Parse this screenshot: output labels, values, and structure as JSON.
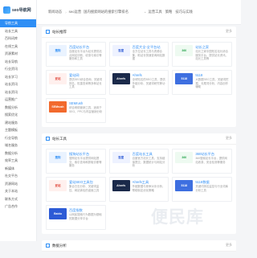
{
  "brand": {
    "name": "seo导航网"
  },
  "topbar": {
    "item1": "新闻动态",
    "item2": "seo运营",
    "item3": "国内搜索网站的搜索引擎排名",
    "item4": "运营工具",
    "item5": "策略",
    "item6": "技巧与实践"
  },
  "sidebar": {
    "items": [
      "导航工具",
      "站长工具",
      "百科词库",
      "在线工具",
      "资源素材",
      "站长导航",
      "行业资讯",
      "站长学习",
      "站长资讯",
      "站长资讯",
      "运营推广",
      "数据分析",
      "搜索优化",
      "建站服务",
      "主题模板",
      "行业导航",
      "域名服务",
      "数据分析",
      "效率工具",
      "新媒体",
      "社交平台",
      "资源网站",
      "关于本站",
      "联系方式",
      "广告合作"
    ]
  },
  "sections": [
    {
      "title": "站长推荐",
      "more": "更多",
      "cards": [
        {
          "logo": "搜狗",
          "logo_color": "#2e8ef5",
          "logo_bg": "#eaf3ff",
          "title": "百度站长平台",
          "desc": "百度站长平台为站长提供站点网站诊断、收录与索引等服务和工具"
        },
        {
          "logo": "百度",
          "logo_color": "#2d5bd6",
          "logo_bg": "#eef2ff",
          "title": "百度大全-全平台站",
          "desc": "全方位站长工具与资源合集，助站长快速查询网站数据"
        },
        {
          "logo": "360",
          "logo_color": "#2aa54f",
          "logo_bg": "#eefaf1",
          "title": "站长之家",
          "desc": "站长之家中国知名站长综合服务平台，提供站长资讯、站长工具等"
        },
        {
          "logo": "爱站",
          "logo_color": "#e04a3f",
          "logo_bg": "#fff0ee",
          "title": "爱站网",
          "desc": "提供SEO综合查询、关键词排名、权重查询等多种站长工具"
        },
        {
          "logo": "Ahrefs",
          "logo_color": "#fff",
          "logo_bg": "#1b2a4a",
          "title": "Ahrefs",
          "desc": "全球知名的SEO工具，提供外链分析、关键词研究等功能"
        },
        {
          "logo": "5118",
          "logo_color": "#fff",
          "logo_bg": "#3e6fe0",
          "title": "5118",
          "desc": "大数据SEO工具，关键词挖掘、长尾词分析、内容创作辅助"
        },
        {
          "logo": "SEMrush",
          "logo_color": "#fff",
          "logo_bg": "#f26a2d",
          "title": "SEMrush",
          "desc": "综合网络营销工具，适用于SEO、PPC与内容营销分析"
        }
      ]
    },
    {
      "title": "站长工具",
      "more": "更多",
      "cards": [
        {
          "logo": "搜狗",
          "logo_color": "#2e8ef5",
          "logo_bg": "#eaf3ff",
          "title": "搜狗站长平台",
          "desc": "搜狗站长平台提供网站提交、索引查询和抓取诊断等服务"
        },
        {
          "logo": "百度",
          "logo_color": "#2d5bd6",
          "logo_bg": "#eef2ff",
          "title": "百度站长工具",
          "desc": "百度官方站长工具，支持链接提交、数据统计与网站分析"
        },
        {
          "logo": "360",
          "logo_color": "#2aa54f",
          "logo_bg": "#eefaf1",
          "title": "360站长平台",
          "desc": "360搜索站长平台，提供网站收录、安全检测等服务"
        },
        {
          "logo": "爱站",
          "logo_color": "#e04a3f",
          "logo_bg": "#fff0ee",
          "title": "爱站SEO工具包",
          "desc": "集合日志分析、关键词监控、网站体检的桌面工具"
        },
        {
          "logo": "Ahrefs",
          "logo_color": "#fff",
          "logo_bg": "#1b2a4a",
          "title": "Ahrefs工具",
          "desc": "外链数据与竞争对手分析，帮助制定优化策略"
        },
        {
          "logo": "5118",
          "logo_color": "#fff",
          "logo_bg": "#3e6fe0",
          "title": "5118数据",
          "desc": "关键词排名监控与行业词库分析工具"
        },
        {
          "logo": "Baidu",
          "logo_color": "#fff",
          "logo_bg": "#2d5bd6",
          "title": "百度指数",
          "desc": "以网民搜索行为数据为基础的数据分享平台"
        }
      ]
    },
    {
      "title": "数据分析",
      "more": "更多"
    }
  ],
  "watermark": "便民库",
  "colors": {
    "accent": "#2e8ef5",
    "sidebar_active": "#2e8ef5",
    "bg": "#f4f5f7"
  }
}
